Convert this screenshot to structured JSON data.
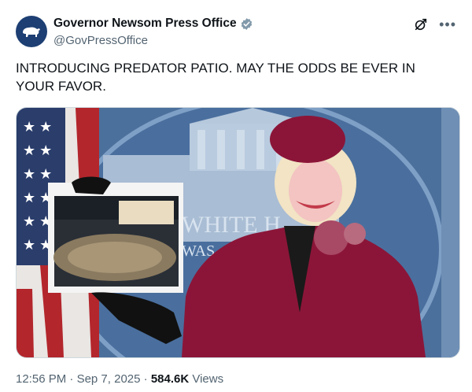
{
  "account": {
    "display_name": "Governor Newsom Press Office",
    "handle": "@GovPressOffice",
    "verified": true,
    "avatar_color": "#1d3f73"
  },
  "tweet": {
    "text": "INTRODUCING PREDATOR PATIO. MAY THE ODDS BE EVER IN YOUR FAVOR.",
    "media": {
      "podium_text_1": "WHITE H",
      "podium_text_2": "WAS"
    }
  },
  "meta": {
    "time": "12:56 PM",
    "separator": "·",
    "date": "Sep 7, 2025",
    "views_count": "584.6K",
    "views_label": "Views"
  },
  "icons": [
    "grok-icon",
    "more-options-icon",
    "verified-badge-icon",
    "bear-logo-icon"
  ]
}
